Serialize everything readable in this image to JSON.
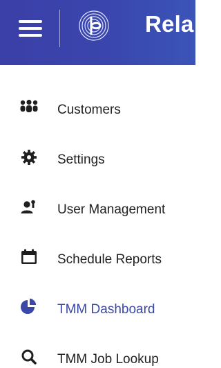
{
  "header": {
    "title": "Rela",
    "background_color": "#3a45ab",
    "menu_icon": "hamburger-icon",
    "logo_icon": "circular-b-logo"
  },
  "sidebar": {
    "items": [
      {
        "label": "Customers",
        "icon": "users-group-icon",
        "active": false
      },
      {
        "label": "Settings",
        "icon": "gear-icon",
        "active": false
      },
      {
        "label": "User Management",
        "icon": "user-management-icon",
        "active": false
      },
      {
        "label": "Schedule Reports",
        "icon": "calendar-icon",
        "active": false
      },
      {
        "label": "TMM Dashboard",
        "icon": "pie-chart-icon",
        "active": true
      },
      {
        "label": "TMM Job Lookup",
        "icon": "search-icon",
        "active": false
      }
    ],
    "text_color": "#222222",
    "active_color": "#3b48a8"
  }
}
